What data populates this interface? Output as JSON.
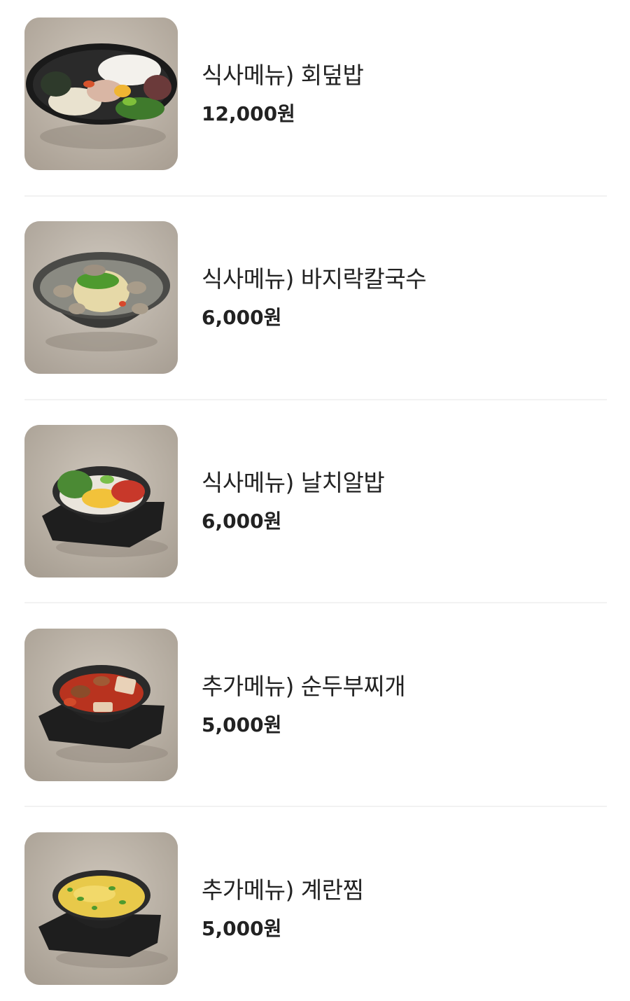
{
  "menu": {
    "items": [
      {
        "name": "식사메뉴) 회덮밥",
        "price": "12,000원",
        "photo": "bowl-hoedeopbap"
      },
      {
        "name": "식사메뉴) 바지락칼국수",
        "price": "6,000원",
        "photo": "bowl-kalguksu"
      },
      {
        "name": "식사메뉴) 날치알밥",
        "price": "6,000원",
        "photo": "stone-pot-rice"
      },
      {
        "name": "추가메뉴) 순두부찌개",
        "price": "5,000원",
        "photo": "stone-pot-stew"
      },
      {
        "name": "추가메뉴) 계란찜",
        "price": "5,000원",
        "photo": "stone-pot-egg"
      }
    ]
  }
}
